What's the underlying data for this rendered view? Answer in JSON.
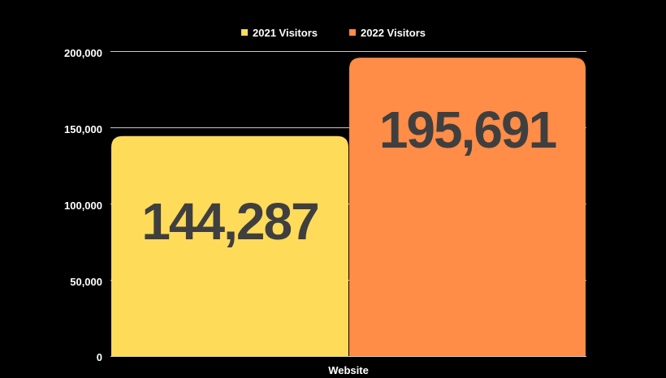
{
  "background": "#000000",
  "chart_data": {
    "type": "bar",
    "categories": [
      "Website"
    ],
    "series": [
      {
        "name": "2021 Visitors",
        "values": [
          144287
        ],
        "color": "#FFDB5A",
        "data_label": "144,287"
      },
      {
        "name": "2022 Visitors",
        "values": [
          195691
        ],
        "color": "#FF8C47",
        "data_label": "195,691"
      }
    ],
    "y_ticks": [
      0,
      50000,
      100000,
      150000,
      200000
    ],
    "y_tick_labels": [
      "0",
      "50,000",
      "100,000",
      "150,000",
      "200,000"
    ],
    "ylim": [
      0,
      200000
    ],
    "grid": true,
    "gridline_color": "#c8c8c8",
    "legend_position": "top-center"
  }
}
